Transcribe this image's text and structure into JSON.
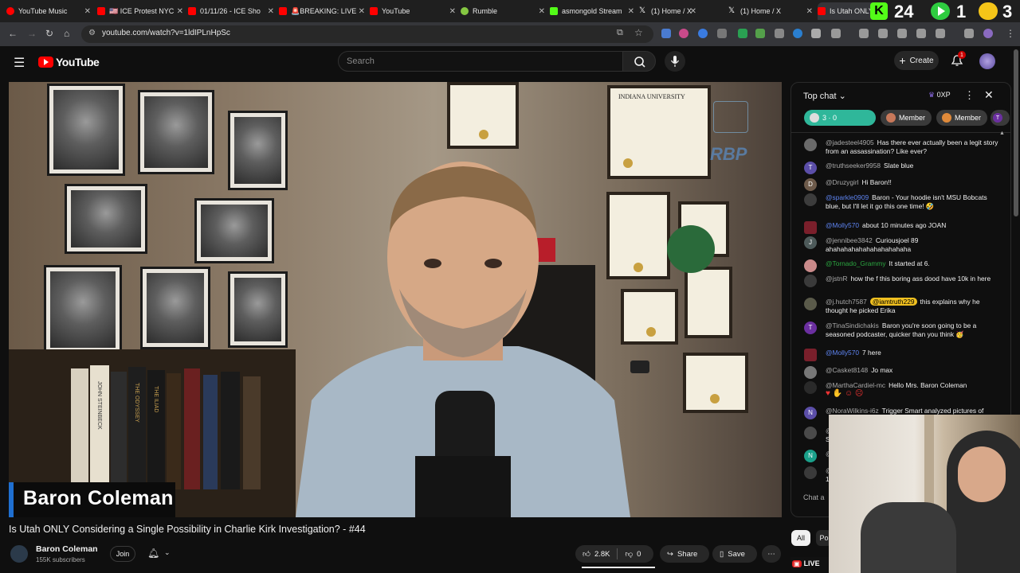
{
  "browser": {
    "tabs": [
      {
        "label": "YouTube Music",
        "color": "#ff0000"
      },
      {
        "label": "🇺🇸 ICE Protest NYC",
        "color": "#ff0000"
      },
      {
        "label": "01/11/26 - ICE Sho",
        "color": "#ff0000"
      },
      {
        "label": "🚨BREAKING: LIVE",
        "color": "#ff0000"
      },
      {
        "label": "YouTube",
        "color": "#ff0000"
      },
      {
        "label": "Rumble",
        "color": "#85c742"
      },
      {
        "label": "asmongold Stream",
        "color": "#53fc18"
      },
      {
        "label": "(1) Home / X",
        "color": "#ffffff"
      },
      {
        "label": "(1) Home / X",
        "color": "#ffffff"
      },
      {
        "label": "Is Utah ONLY",
        "color": "#ff0000"
      }
    ],
    "url": "youtube.com/watch?v=1ldIPLnHpSc",
    "overlay": {
      "count_a": "24",
      "count_b": "1",
      "count_c": "3"
    }
  },
  "header": {
    "logo_text": "YouTube",
    "search_placeholder": "Search",
    "create_label": "Create",
    "notification_count": "1"
  },
  "video": {
    "nameplate": "Baron Coleman",
    "diploma_header": "INDIANA UNIVERSITY",
    "watermark": "RBP",
    "book_titles": [
      "JOHN STEINBECK",
      "THE ODYSSEY",
      "THE ILIAD"
    ]
  },
  "below": {
    "title": "Is Utah ONLY Considering a Single Possibility in Charlie Kirk Investigation? - #44",
    "channel_name": "Baron Coleman",
    "subscribers": "155K subscribers",
    "join_label": "Join",
    "like_count": "2.8K",
    "dislike_count": "0",
    "share_label": "Share",
    "save_label": "Save"
  },
  "chat": {
    "mode_label": "Top chat",
    "points": "0XP",
    "chips": [
      {
        "label": "3 · 0",
        "color": "#2fb79a"
      },
      {
        "label": "Member",
        "color": "#3a3a3a"
      },
      {
        "label": "Member",
        "color": "#3a3a3a"
      },
      {
        "label": "T",
        "color": "#3a3a3a"
      }
    ],
    "messages": [
      {
        "author": "@jadesteel4905",
        "text": "Has there ever actually been a legit story from an assassination? Like ever?",
        "initial": "",
        "color": "#6a6a6a"
      },
      {
        "author": "@truthseeker9958",
        "text": "Slate blue",
        "initial": "T",
        "color": "#5b4ea8"
      },
      {
        "author": "@Druzygirl",
        "text": "Hi Baron!!",
        "initial": "D",
        "color": "#6d5a4a"
      },
      {
        "author": "@sparkle0909",
        "text": "Baron - Your hoodie isn't MSU Bobcats blue, but I'll let it go this one time! 🤣",
        "initial": "",
        "color": "#3c3c3c"
      },
      {
        "author": "@Molly570",
        "text": "about 10 minutes ago JOAN",
        "initial": "",
        "color": "#7a1f2b"
      },
      {
        "author": "@jennibee3842",
        "text": "Curiousjoel 89 ahahahahahahahahahahaha",
        "initial": "J",
        "color": "#4d5a5a"
      },
      {
        "author": "@Tornado_Grammy",
        "text": "It started at 6.",
        "initial": "",
        "color": "#c98a8a"
      },
      {
        "author": "@jstnR",
        "text": "how the f this boring ass dood have 10k in here",
        "initial": "",
        "color": "#3a3a3a"
      },
      {
        "author": "@j.hutch7587",
        "text": "this explains why he thought he picked Erika",
        "mention": "@iamtruth229",
        "initial": "",
        "color": "#5a5a4a"
      },
      {
        "author": "@TinaSindichakis",
        "text": "Baron you're soon going to be a seasoned podcaster, quicker than you think 🥳",
        "initial": "T",
        "color": "#6b2fa0"
      },
      {
        "author": "@Molly570",
        "text": "7 here",
        "initial": "",
        "color": "#7a1f2b"
      },
      {
        "author": "@Casket8148",
        "text": "Jo max",
        "initial": "",
        "color": "#777777"
      },
      {
        "author": "@MarthaCardiel-mc",
        "text": "Hello Mrs. Baron Coleman",
        "initial": "",
        "color": "#2a2a2a"
      },
      {
        "author": "@NoraWilkins-i6z",
        "text": "Trigger Smart analyzed pictures of",
        "initial": "N",
        "color": "#5b4ea8"
      },
      {
        "author": "@",
        "text": "St",
        "initial": "",
        "color": "#4a4a4a"
      },
      {
        "author": "@",
        "text": "",
        "initial": "N",
        "color": "#1aa08a"
      },
      {
        "author": "@",
        "text": "1",
        "initial": "",
        "color": "#3a3a3a"
      }
    ],
    "input_placeholder": "Chat a"
  },
  "right_chips": {
    "all_label": "All",
    "second_label": "Po"
  },
  "live_badge": "LIVE"
}
